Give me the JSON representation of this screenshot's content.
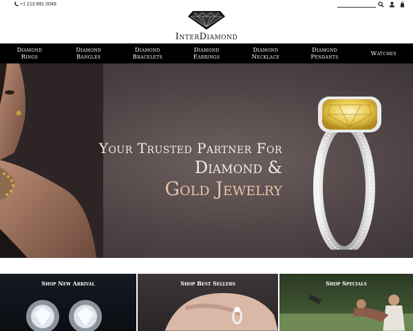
{
  "topbar": {
    "phone": "+1 213 891 0049",
    "search_placeholder": ""
  },
  "logo": {
    "text": "InterDiamond"
  },
  "nav": {
    "items": [
      "Diamond\nRings",
      "Diamond\nBangles",
      "Diamond\nBracelets",
      "Diamond\nEarrings",
      "Diamond\nNecklace",
      "Diamond\nPendants",
      "Watches"
    ]
  },
  "hero": {
    "line1": "Your Trusted Partner For",
    "line2": "Diamond &",
    "line3": "Gold Jewelry"
  },
  "categories": [
    "Shop New Arrival",
    "Shop Best Sellers",
    "Shop Specials"
  ],
  "colors": {
    "nav_bg": "#000000",
    "hero_accent": "#e8c3a6",
    "hero_text": "#f2ece6"
  },
  "icons": [
    "phone-icon",
    "search-icon",
    "user-icon",
    "cart-icon",
    "diamond-logo-icon"
  ]
}
